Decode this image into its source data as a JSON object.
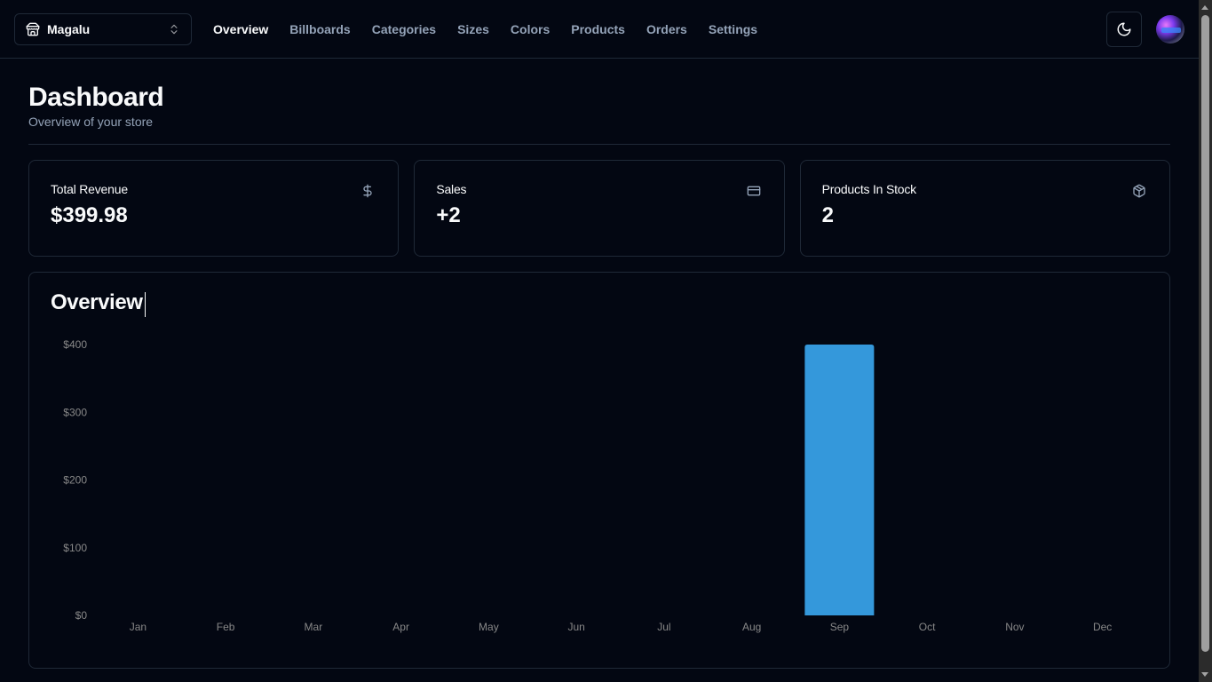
{
  "header": {
    "store_switcher": {
      "label": "Magalu",
      "icon": "store-icon",
      "chevron_icon": "chevrons-up-down-icon"
    },
    "nav": [
      {
        "label": "Overview",
        "active": true
      },
      {
        "label": "Billboards",
        "active": false
      },
      {
        "label": "Categories",
        "active": false
      },
      {
        "label": "Sizes",
        "active": false
      },
      {
        "label": "Colors",
        "active": false
      },
      {
        "label": "Products",
        "active": false
      },
      {
        "label": "Orders",
        "active": false
      },
      {
        "label": "Settings",
        "active": false
      }
    ],
    "theme_toggle_icon": "moon-icon",
    "avatar": "user-avatar"
  },
  "page": {
    "title": "Dashboard",
    "subtitle": "Overview of your store"
  },
  "cards": [
    {
      "label": "Total Revenue",
      "value": "$399.98",
      "icon": "dollar-sign-icon"
    },
    {
      "label": "Sales",
      "value": "+2",
      "icon": "credit-card-icon"
    },
    {
      "label": "Products In Stock",
      "value": "2",
      "icon": "package-icon"
    }
  ],
  "overview": {
    "title": "Overview"
  },
  "colors": {
    "bar": "#3498db",
    "background": "#030712",
    "border": "#1f2937",
    "muted": "#94a3b8"
  },
  "chart_data": {
    "type": "bar",
    "title": "Overview",
    "categories": [
      "Jan",
      "Feb",
      "Mar",
      "Apr",
      "May",
      "Jun",
      "Jul",
      "Aug",
      "Sep",
      "Oct",
      "Nov",
      "Dec"
    ],
    "values": [
      0,
      0,
      0,
      0,
      0,
      0,
      0,
      0,
      399.98,
      0,
      0,
      0
    ],
    "xlabel": "",
    "ylabel": "",
    "ylim": [
      0,
      400
    ],
    "yticks": [
      0,
      100,
      200,
      300,
      400
    ],
    "ytick_labels": [
      "$0",
      "$100",
      "$200",
      "$300",
      "$400"
    ],
    "grid": false,
    "legend": "none"
  }
}
